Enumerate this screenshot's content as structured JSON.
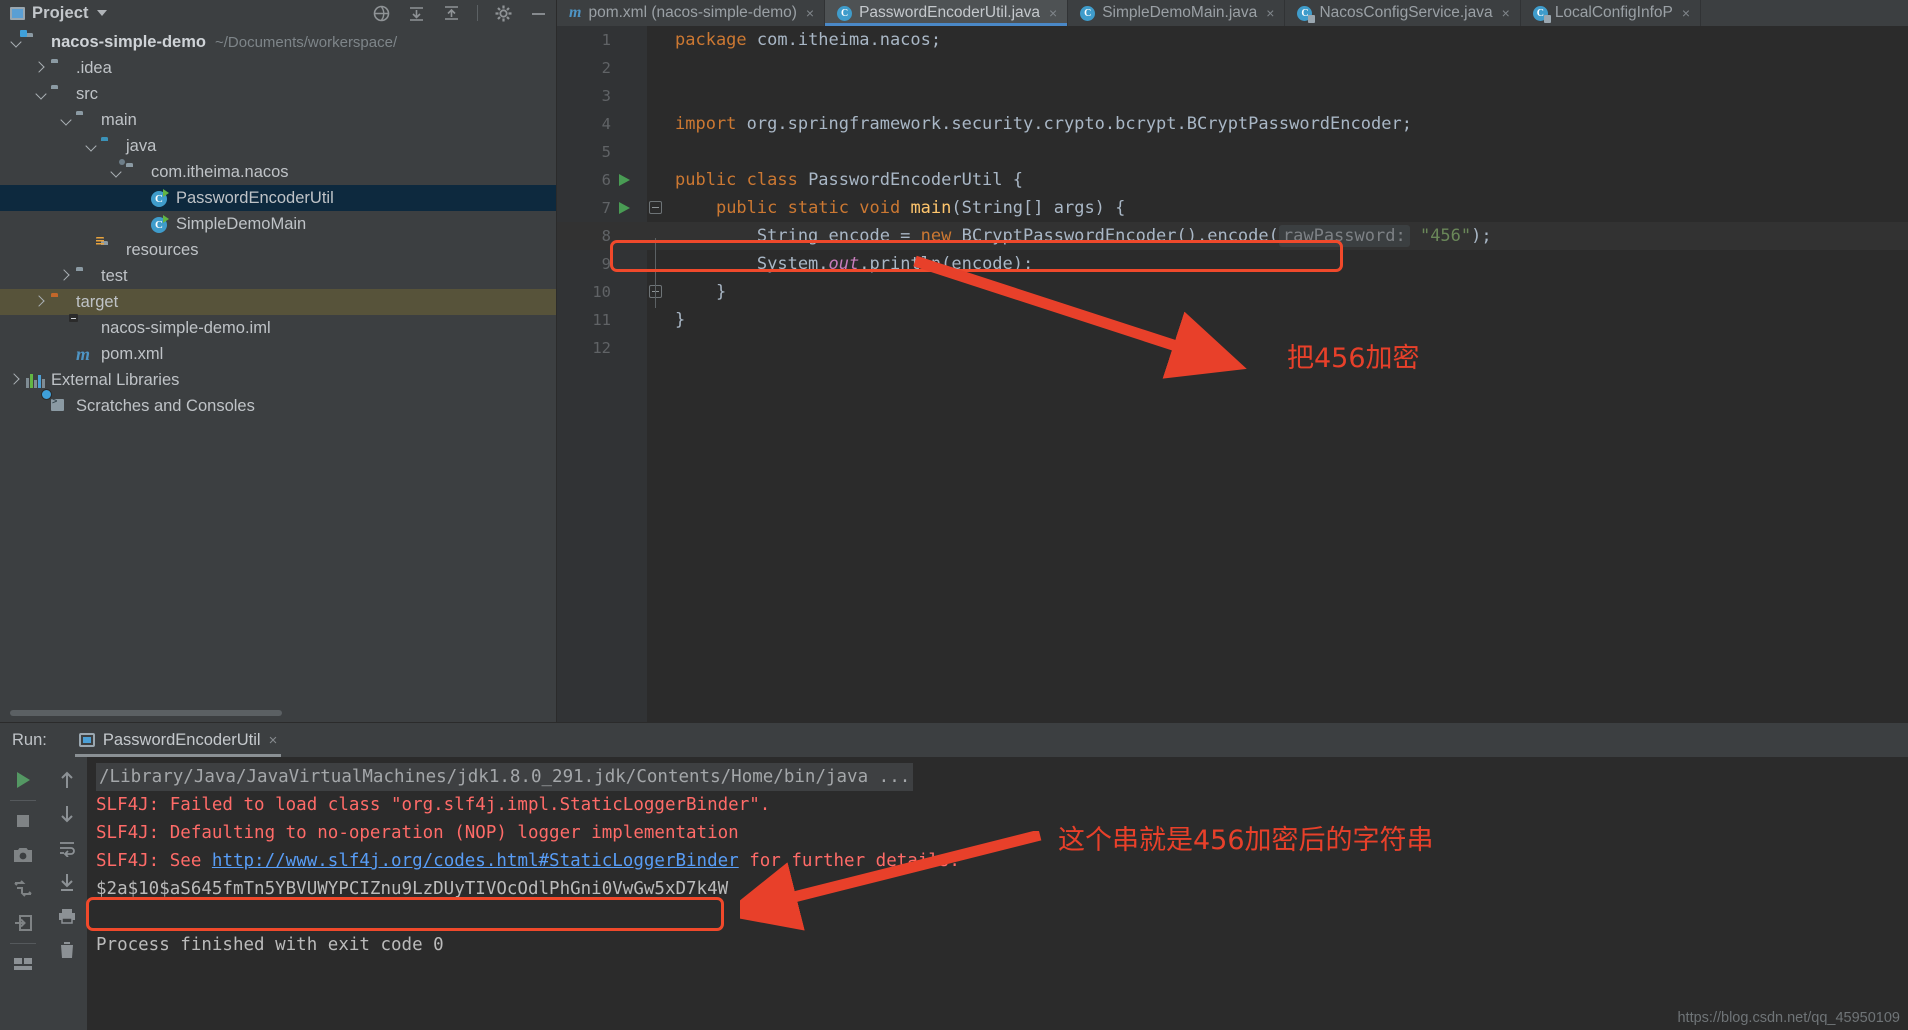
{
  "sidebar": {
    "title": "Project",
    "tools": [
      "hide-icon",
      "collapse-all-icon",
      "expand-icon",
      "settings-icon",
      "minimize-icon"
    ],
    "tree": [
      {
        "label": "nacos-simple-demo",
        "path": "~/Documents/workerspace/",
        "icon": "module-folder-icon",
        "indent": 0,
        "arrow": "open",
        "bold": true,
        "state": "normal"
      },
      {
        "label": ".idea",
        "path": "",
        "icon": "folder-icon",
        "indent": 1,
        "arrow": "closed",
        "bold": false,
        "state": "normal"
      },
      {
        "label": "src",
        "path": "",
        "icon": "folder-icon",
        "indent": 1,
        "arrow": "open",
        "bold": false,
        "state": "normal"
      },
      {
        "label": "main",
        "path": "",
        "icon": "folder-icon",
        "indent": 2,
        "arrow": "open",
        "bold": false,
        "state": "normal"
      },
      {
        "label": "java",
        "path": "",
        "icon": "source-folder-icon",
        "indent": 3,
        "arrow": "open",
        "bold": false,
        "state": "normal"
      },
      {
        "label": "com.itheima.nacos",
        "path": "",
        "icon": "package-icon",
        "indent": 4,
        "arrow": "open",
        "bold": false,
        "state": "normal"
      },
      {
        "label": "PasswordEncoderUtil",
        "path": "",
        "icon": "java-class-icon",
        "indent": 5,
        "arrow": "none",
        "bold": false,
        "state": "selected"
      },
      {
        "label": "SimpleDemoMain",
        "path": "",
        "icon": "java-class-icon",
        "indent": 5,
        "arrow": "none",
        "bold": false,
        "state": "normal"
      },
      {
        "label": "resources",
        "path": "",
        "icon": "resources-folder-icon",
        "indent": 3,
        "arrow": "none",
        "bold": false,
        "state": "normal"
      },
      {
        "label": "test",
        "path": "",
        "icon": "folder-icon",
        "indent": 2,
        "arrow": "closed",
        "bold": false,
        "state": "normal"
      },
      {
        "label": "target",
        "path": "",
        "icon": "excluded-folder-icon",
        "indent": 1,
        "arrow": "closed",
        "bold": false,
        "state": "highlight"
      },
      {
        "label": "nacos-simple-demo.iml",
        "path": "",
        "icon": "iml-file-icon",
        "indent": 2,
        "arrow": "none",
        "bold": false,
        "state": "normal"
      },
      {
        "label": "pom.xml",
        "path": "",
        "icon": "maven-pom-icon",
        "indent": 2,
        "arrow": "none",
        "bold": false,
        "state": "normal"
      },
      {
        "label": "External Libraries",
        "path": "",
        "icon": "libraries-icon",
        "indent": 0,
        "arrow": "closed",
        "bold": false,
        "state": "normal"
      },
      {
        "label": "Scratches and Consoles",
        "path": "",
        "icon": "scratches-icon",
        "indent": 1,
        "arrow": "none",
        "bold": false,
        "state": "normal"
      }
    ]
  },
  "tabs": [
    {
      "label": "pom.xml (nacos-simple-demo)",
      "icon": "maven-pom-icon",
      "active": false
    },
    {
      "label": "PasswordEncoderUtil.java",
      "icon": "java-class-icon",
      "active": true
    },
    {
      "label": "SimpleDemoMain.java",
      "icon": "java-class-icon",
      "active": false
    },
    {
      "label": "NacosConfigService.java",
      "icon": "java-class-readonly-icon",
      "active": false
    },
    {
      "label": "LocalConfigInfoP",
      "icon": "java-class-readonly-icon",
      "active": false
    }
  ],
  "editor": {
    "lines": [
      {
        "num": "1",
        "gutter_run": false,
        "fold": false,
        "highlight": false,
        "segments": [
          {
            "t": "package",
            "c": "kw"
          },
          {
            "t": " com.itheima.nacos;",
            "c": ""
          }
        ]
      },
      {
        "num": "2",
        "gutter_run": false,
        "fold": false,
        "highlight": false,
        "segments": []
      },
      {
        "num": "3",
        "gutter_run": false,
        "fold": false,
        "highlight": false,
        "segments": []
      },
      {
        "num": "4",
        "gutter_run": false,
        "fold": false,
        "highlight": false,
        "segments": [
          {
            "t": "import",
            "c": "kw"
          },
          {
            "t": " org.springframework.security.crypto.bcrypt.BCryptPasswordEncoder;",
            "c": ""
          }
        ]
      },
      {
        "num": "5",
        "gutter_run": false,
        "fold": false,
        "highlight": false,
        "segments": []
      },
      {
        "num": "6",
        "gutter_run": true,
        "fold": false,
        "highlight": false,
        "segments": [
          {
            "t": "public class",
            "c": "kw"
          },
          {
            "t": " PasswordEncoderUtil {",
            "c": ""
          }
        ]
      },
      {
        "num": "7",
        "gutter_run": true,
        "fold": true,
        "highlight": false,
        "segments": [
          {
            "t": "    ",
            "c": ""
          },
          {
            "t": "public static void",
            "c": "kw"
          },
          {
            "t": " ",
            "c": ""
          },
          {
            "t": "main",
            "c": "fnm"
          },
          {
            "t": "(String[] args) {",
            "c": ""
          }
        ]
      },
      {
        "num": "8",
        "gutter_run": false,
        "fold": false,
        "highlight": true,
        "segments": [
          {
            "t": "        String encode = ",
            "c": ""
          },
          {
            "t": "new",
            "c": "kw"
          },
          {
            "t": " BCryptPasswordEncoder().encode(",
            "c": ""
          },
          {
            "t": "rawPassword:",
            "c": "hint"
          },
          {
            "t": " ",
            "c": ""
          },
          {
            "t": "\"456\"",
            "c": "str"
          },
          {
            "t": ");",
            "c": ""
          }
        ]
      },
      {
        "num": "9",
        "gutter_run": false,
        "fold": false,
        "highlight": false,
        "segments": [
          {
            "t": "        System.",
            "c": ""
          },
          {
            "t": "out",
            "c": "stat"
          },
          {
            "t": ".println(encode);",
            "c": ""
          }
        ]
      },
      {
        "num": "10",
        "gutter_run": false,
        "fold": true,
        "highlight": false,
        "segments": [
          {
            "t": "    }",
            "c": ""
          }
        ]
      },
      {
        "num": "11",
        "gutter_run": false,
        "fold": false,
        "highlight": false,
        "segments": [
          {
            "t": "}",
            "c": ""
          }
        ]
      },
      {
        "num": "12",
        "gutter_run": false,
        "fold": false,
        "highlight": false,
        "segments": []
      }
    ],
    "annotation_encrypt": "把456加密",
    "annotation_color": "#e8402a"
  },
  "run_panel": {
    "run_label": "Run:",
    "tab_name": "PasswordEncoderUtil",
    "close_label": "×",
    "toolbar_left": [
      "rerun-icon",
      "stop-icon",
      "camera-icon",
      "trace-icon",
      "export-icon",
      "layout-icon"
    ],
    "toolbar_right": [
      "scroll-up-icon",
      "scroll-down-icon",
      "soft-wrap-icon",
      "scroll-to-end-icon",
      "print-icon",
      "trash-icon"
    ],
    "console": [
      {
        "text": "/Library/Java/JavaVirtualMachines/jdk1.8.0_291.jdk/Contents/Home/bin/java ...",
        "kind": "cmd"
      },
      {
        "text": "SLF4J: Failed to load class \"org.slf4j.impl.StaticLoggerBinder\".",
        "kind": "err"
      },
      {
        "text": "SLF4J: Defaulting to no-operation (NOP) logger implementation",
        "kind": "err"
      },
      {
        "text": "SLF4J: See ",
        "kind": "err",
        "link": "http://www.slf4j.org/codes.html#StaticLoggerBinder",
        "after": " for further details."
      },
      {
        "text": "$2a$10$aS645fmTn5YBVUWYPCIZnu9LzDUyTIVOcOdlPhGni0VwGw5xD7k4W",
        "kind": "out"
      },
      {
        "text": "",
        "kind": "out"
      },
      {
        "text": "Process finished with exit code 0",
        "kind": "out"
      }
    ],
    "annotation_hash": "这个串就是456加密后的字符串"
  },
  "watermark": "https://blog.csdn.net/qq_45950109"
}
